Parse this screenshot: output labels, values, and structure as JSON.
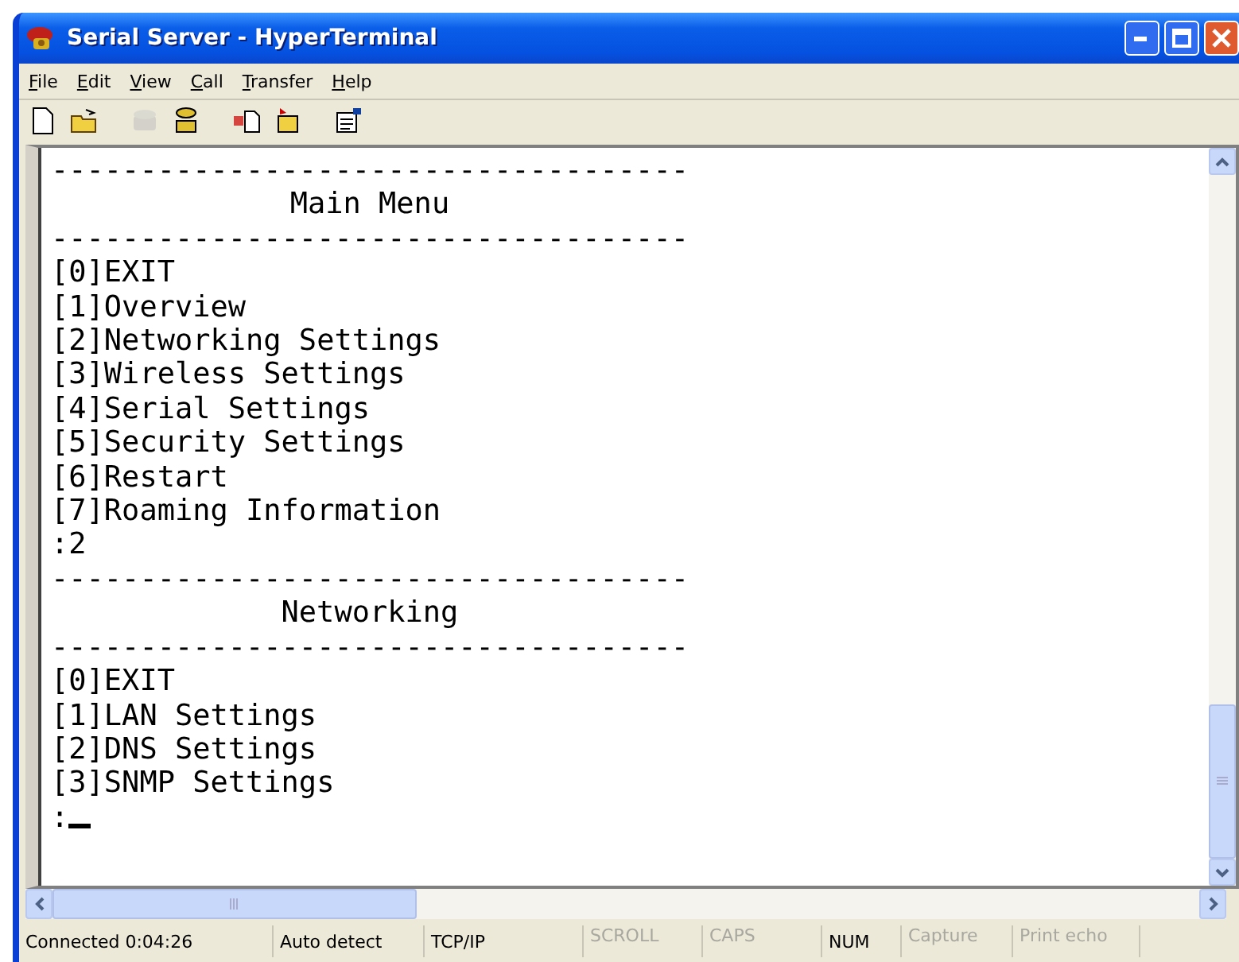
{
  "window": {
    "title": "Serial Server - HyperTerminal"
  },
  "menu": [
    {
      "mnemonic": "F",
      "rest": "ile"
    },
    {
      "mnemonic": "E",
      "rest": "dit"
    },
    {
      "mnemonic": "V",
      "rest": "iew"
    },
    {
      "mnemonic": "C",
      "rest": "all"
    },
    {
      "mnemonic": "T",
      "rest": "ransfer"
    },
    {
      "mnemonic": "H",
      "rest": "elp"
    }
  ],
  "toolbar": [
    {
      "kind": "new",
      "disabled": false
    },
    {
      "kind": "open",
      "disabled": false
    },
    {
      "kind": "sep"
    },
    {
      "kind": "call",
      "disabled": true
    },
    {
      "kind": "disconnect",
      "disabled": false
    },
    {
      "kind": "sep"
    },
    {
      "kind": "send",
      "disabled": false
    },
    {
      "kind": "receive",
      "disabled": false
    },
    {
      "kind": "sep"
    },
    {
      "kind": "properties",
      "disabled": false
    }
  ],
  "terminal": {
    "lines": [
      {
        "kind": "rule",
        "text": "------------------------------------"
      },
      {
        "kind": "heading",
        "text": "Main Menu"
      },
      {
        "kind": "rule",
        "text": "------------------------------------"
      },
      {
        "kind": "line",
        "text": "[0]EXIT"
      },
      {
        "kind": "line",
        "text": "[1]Overview"
      },
      {
        "kind": "line",
        "text": "[2]Networking Settings"
      },
      {
        "kind": "line",
        "text": "[3]Wireless Settings"
      },
      {
        "kind": "line",
        "text": "[4]Serial Settings"
      },
      {
        "kind": "line",
        "text": "[5]Security Settings"
      },
      {
        "kind": "line",
        "text": "[6]Restart"
      },
      {
        "kind": "line",
        "text": "[7]Roaming Information"
      },
      {
        "kind": "line",
        "text": ":2"
      },
      {
        "kind": "rule",
        "text": "------------------------------------"
      },
      {
        "kind": "heading",
        "text": "Networking"
      },
      {
        "kind": "rule",
        "text": "------------------------------------"
      },
      {
        "kind": "line",
        "text": "[0]EXIT"
      },
      {
        "kind": "line",
        "text": "[1]LAN Settings"
      },
      {
        "kind": "line",
        "text": "[2]DNS Settings"
      },
      {
        "kind": "line",
        "text": "[3]SNMP Settings"
      },
      {
        "kind": "prompt",
        "text": ":"
      }
    ]
  },
  "status_bar": [
    {
      "label": "Connected 0:04:26",
      "active": true
    },
    {
      "label": "Auto detect",
      "active": true
    },
    {
      "label": "TCP/IP",
      "active": true
    },
    {
      "label": "SCROLL",
      "active": false
    },
    {
      "label": "CAPS",
      "active": false
    },
    {
      "label": "NUM",
      "active": true
    },
    {
      "label": "Capture",
      "active": false
    },
    {
      "label": "Print echo",
      "active": false
    }
  ]
}
